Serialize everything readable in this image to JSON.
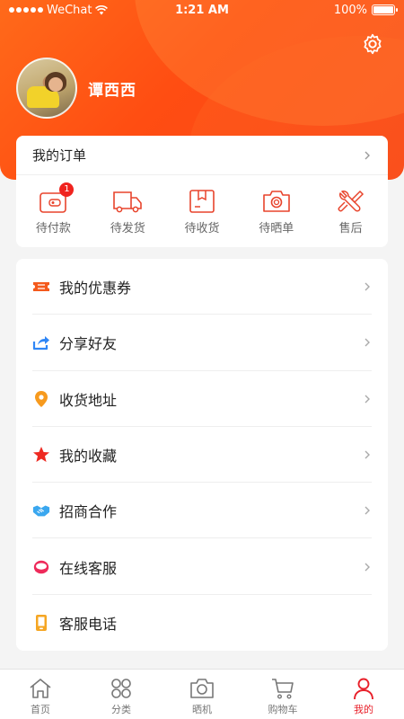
{
  "status_bar": {
    "carrier": "WeChat",
    "time": "1:21 AM",
    "battery": "100%"
  },
  "profile": {
    "username": "谭西西"
  },
  "orders": {
    "title": "我的订单",
    "items": [
      {
        "label": "待付款",
        "icon": "wallet-icon",
        "badge": "1"
      },
      {
        "label": "待发货",
        "icon": "truck-icon"
      },
      {
        "label": "待收货",
        "icon": "package-icon"
      },
      {
        "label": "待晒单",
        "icon": "camera-icon"
      },
      {
        "label": "售后",
        "icon": "tools-icon"
      }
    ]
  },
  "menu": {
    "items": [
      {
        "label": "我的优惠券",
        "icon": "coupon-icon",
        "color": "#f45a1d"
      },
      {
        "label": "分享好友",
        "icon": "share-icon",
        "color": "#2f86f6"
      },
      {
        "label": "收货地址",
        "icon": "location-pin-icon",
        "color": "#f79a1e"
      },
      {
        "label": "我的收藏",
        "icon": "star-icon",
        "color": "#ee2a22"
      },
      {
        "label": "招商合作",
        "icon": "handshake-icon",
        "color": "#3aa7ef"
      },
      {
        "label": "在线客服",
        "icon": "headset-icon",
        "color": "#ee2a5a"
      },
      {
        "label": "客服电话",
        "icon": "phone-icon",
        "color": "#f5a623"
      }
    ]
  },
  "tabbar": {
    "items": [
      {
        "label": "首页",
        "icon": "home-icon"
      },
      {
        "label": "分类",
        "icon": "category-icon"
      },
      {
        "label": "晒机",
        "icon": "camera-icon"
      },
      {
        "label": "购物车",
        "icon": "cart-icon"
      },
      {
        "label": "我的",
        "icon": "profile-icon",
        "active": true
      }
    ]
  },
  "colors": {
    "brand": "#ff5a1a",
    "active_tab": "#e8202a",
    "badge": "#f0231e"
  }
}
